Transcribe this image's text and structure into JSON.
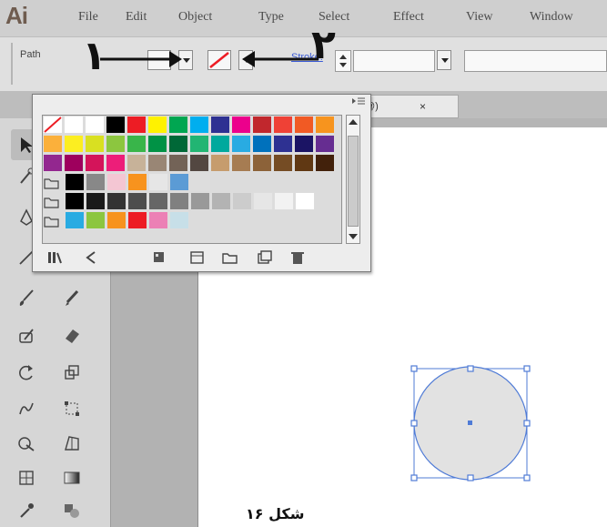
{
  "app": {
    "logo": "Ai"
  },
  "menu": {
    "items": [
      "File",
      "Edit",
      "Object",
      "Type",
      "Select",
      "Effect",
      "View",
      "Window"
    ]
  },
  "control_bar": {
    "path_label": "Path",
    "stroke_label": "Stroke:"
  },
  "annotations": {
    "label_1": "١",
    "label_2": "٢"
  },
  "document_tab": {
    "title": "@)",
    "close": "×"
  },
  "swatches_panel": {
    "menu_icon": "panel-menu-icon",
    "footer_buttons": [
      "swatch-libraries-icon",
      "show-kinds-icon",
      "swatch-options-icon",
      "color-group-icon",
      "new-folder-icon",
      "new-swatch-icon",
      "delete-icon"
    ],
    "rows": [
      [
        "none",
        "#ffffff",
        "#ffffff",
        "#000000",
        "#ed1c24",
        "#fff200",
        "#00a651",
        "#00aeef",
        "#2e3192",
        "#ec008c",
        "#c1272d",
        "#ef4136",
        "#f15a24",
        "#f7941e"
      ],
      [
        "#fbb03b",
        "#fcee21",
        "#d9e021",
        "#8cc63f",
        "#39b54a",
        "#009245",
        "#006837",
        "#22b573",
        "#00a99d",
        "#29abe2",
        "#0071bc",
        "#2e3192",
        "#1b1464",
        "#662d91"
      ],
      [
        "#93278f",
        "#9e005d",
        "#d4145a",
        "#ed1e79",
        "#c7b299",
        "#998675",
        "#736357",
        "#534741",
        "#c69c6d",
        "#a67c52",
        "#8c6239",
        "#754c24",
        "#603813",
        "#42210b"
      ],
      [
        "#000000",
        "#888888",
        "#f4c6d3",
        "#f7931e",
        "#e6e6e6",
        "#5b9bd5",
        "#dddddd"
      ],
      [
        "#000000",
        "#1a1a1a",
        "#333333",
        "#4d4d4d",
        "#666666",
        "#808080",
        "#999999",
        "#b3b3b3",
        "#cccccc",
        "#e6e6e6",
        "#f2f2f2",
        "#ffffff"
      ],
      [
        "#29abe2",
        "#8cc63f",
        "#f7931e",
        "#ed1c24",
        "#ec80b5",
        "#c7dfe8"
      ]
    ]
  },
  "caption": "شکل ۱۶"
}
